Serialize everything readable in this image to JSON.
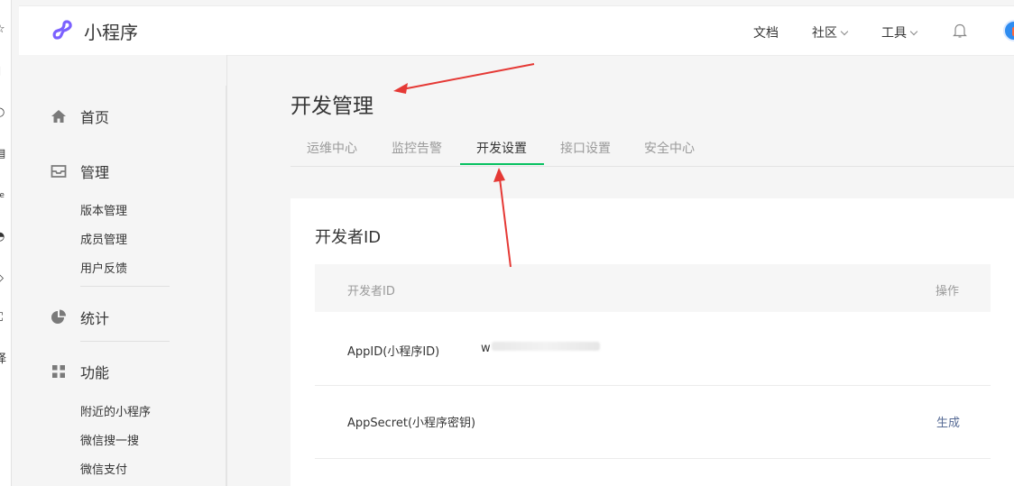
{
  "browser_strip": {
    "icons": [
      "star-icon",
      "tablet-icon",
      "search-icon",
      "calendar-icon",
      "live-icon",
      "clock-icon",
      "clipboard-icon",
      "cart-icon",
      "translate-icon"
    ],
    "partial_glyphs": [
      "☆",
      "◻",
      "○",
      "▤",
      "ve",
      "◔",
      "◇",
      "⛶",
      "译"
    ]
  },
  "header": {
    "brand": "小程序",
    "nav": {
      "docs": "文档",
      "community": "社区",
      "tools": "工具"
    }
  },
  "sidebar": {
    "home": "首页",
    "manage": "管理",
    "manage_items": [
      "版本管理",
      "成员管理",
      "用户反馈"
    ],
    "stats": "统计",
    "features": "功能",
    "feature_items": [
      "附近的小程序",
      "微信搜一搜",
      "微信支付"
    ]
  },
  "main": {
    "title": "开发管理",
    "tabs": [
      "运维中心",
      "监控告警",
      "开发设置",
      "接口设置",
      "安全中心"
    ],
    "active_tab": "开发设置"
  },
  "developer_id": {
    "section_title": "开发者ID",
    "columns": {
      "name": "开发者ID",
      "action": "操作"
    },
    "rows": [
      {
        "label": "AppID(小程序ID)",
        "value": "w",
        "action": ""
      },
      {
        "label": "AppSecret(小程序密钥)",
        "value": "",
        "action": "生成"
      }
    ]
  },
  "colors": {
    "accent_green": "#07c160",
    "link_blue": "#576b95",
    "annotation_red": "#e53935"
  }
}
